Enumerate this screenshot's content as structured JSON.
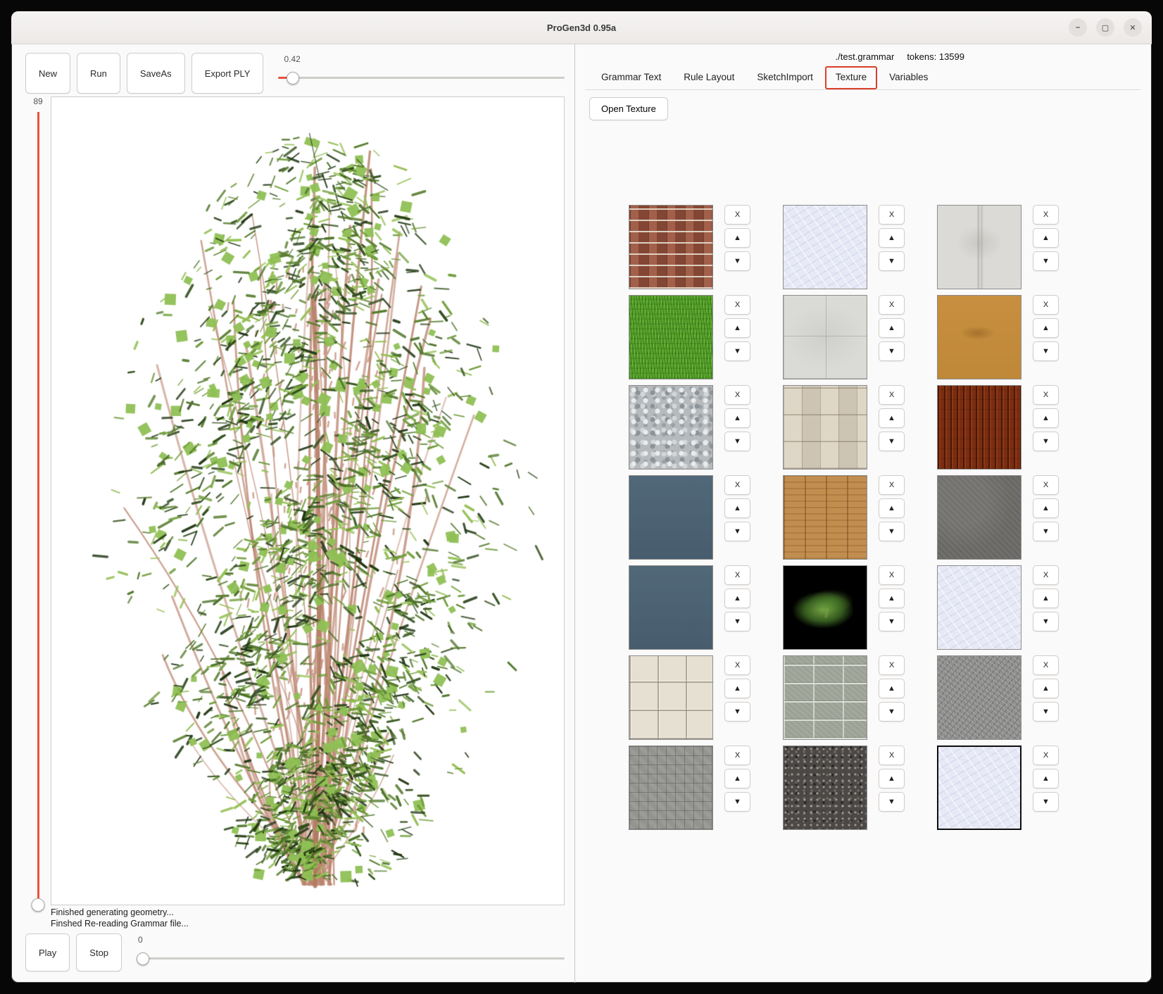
{
  "window": {
    "title": "ProGen3d 0.95a"
  },
  "titlebar_icons": {
    "minimize": "–",
    "maximize": "▢",
    "close": "✕"
  },
  "toolbar": {
    "new": "New",
    "run": "Run",
    "save_as": "SaveAs",
    "export_ply": "Export PLY"
  },
  "top_slider": {
    "value": "0.42"
  },
  "left_slider": {
    "value": "89"
  },
  "bottom_slider": {
    "value": "0"
  },
  "transport": {
    "play": "Play",
    "stop": "Stop"
  },
  "log": {
    "line1": "Finished generating geometry...",
    "line2": "Finshed Re-reading Grammar file..."
  },
  "right_panel": {
    "grammar_file": "./test.grammar",
    "tokens_label": "tokens: 13599",
    "tabs": [
      {
        "label": "Grammar Text"
      },
      {
        "label": "Rule Layout"
      },
      {
        "label": "SketchImport"
      },
      {
        "label": "Texture"
      },
      {
        "label": "Variables"
      }
    ],
    "active_tab": "Texture",
    "open_texture": "Open Texture",
    "item_buttons": {
      "remove": "X",
      "up": "▲",
      "down": "▼"
    },
    "textures": [
      {
        "name": "red-brick",
        "style": "brick",
        "selected": false
      },
      {
        "name": "crinkled-paper",
        "style": "crinkle",
        "selected": false
      },
      {
        "name": "light-plaster",
        "style": "plaster",
        "selected": false
      },
      {
        "name": "grass",
        "style": "grass",
        "selected": false
      },
      {
        "name": "concrete-tiles",
        "style": "tiles",
        "selected": false
      },
      {
        "name": "tan-clay",
        "style": "tan",
        "selected": false
      },
      {
        "name": "gravel",
        "style": "gravel",
        "selected": false
      },
      {
        "name": "stone-tiles",
        "style": "stone",
        "selected": false
      },
      {
        "name": "dark-wood",
        "style": "darkwood",
        "selected": false
      },
      {
        "name": "slate-blue",
        "style": "slate",
        "selected": false
      },
      {
        "name": "oak-planks",
        "style": "oak",
        "selected": false
      },
      {
        "name": "dark-concrete",
        "style": "concrete",
        "selected": false
      },
      {
        "name": "slate-blue-2",
        "style": "slate",
        "selected": false
      },
      {
        "name": "conifer-branch",
        "style": "conifer",
        "selected": false
      },
      {
        "name": "crinkled-paper-2",
        "style": "crinkle",
        "selected": false
      },
      {
        "name": "beige-tiles",
        "style": "beigetile",
        "selected": false
      },
      {
        "name": "concrete-blocks",
        "style": "blockwall",
        "selected": false
      },
      {
        "name": "scratched-gray",
        "style": "scratch",
        "selected": false
      },
      {
        "name": "gray-mosaic",
        "style": "mosaic",
        "selected": false
      },
      {
        "name": "asphalt",
        "style": "asphalt",
        "selected": false
      },
      {
        "name": "crinkled-paper-3",
        "style": "crinkle",
        "selected": true
      }
    ]
  },
  "colors": {
    "accent": "#e8543c",
    "tab_active_border": "#d8402c",
    "selection_border": "#0e0e0e"
  }
}
